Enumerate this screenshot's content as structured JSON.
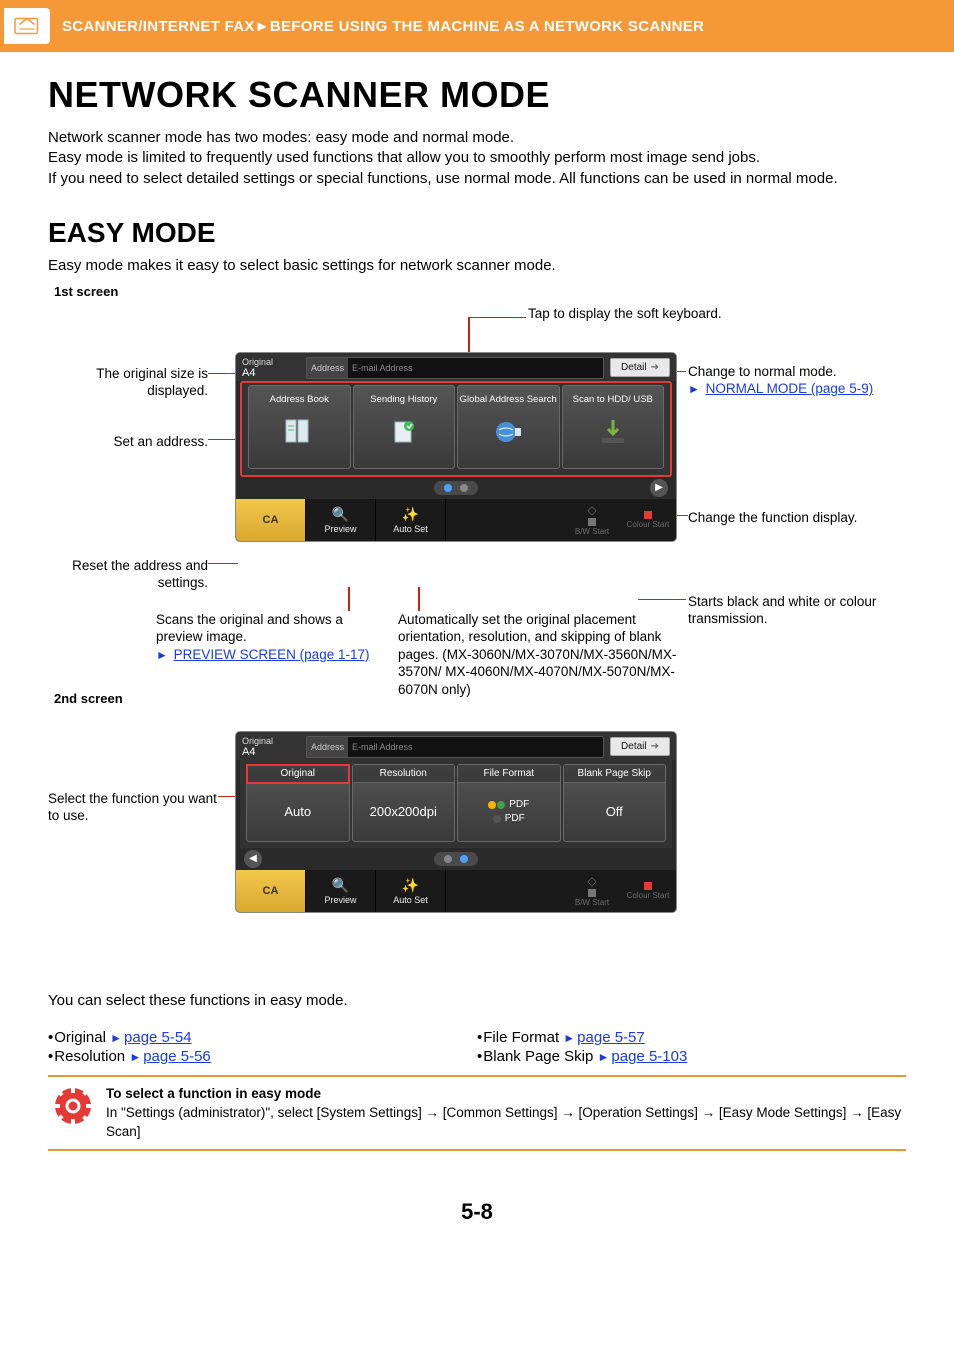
{
  "header": {
    "breadcrumb": "SCANNER/INTERNET FAX►BEFORE USING THE MACHINE AS A NETWORK SCANNER"
  },
  "title": "NETWORK SCANNER MODE",
  "intro": [
    "Network scanner mode has two modes: easy mode and normal mode.",
    "Easy mode is limited to frequently used functions that allow you to smoothly perform most image send jobs.",
    "If you need to select detailed settings or special functions, use normal mode. All functions can be used in normal mode."
  ],
  "easy": {
    "heading": "EASY MODE",
    "desc": "Easy mode makes it easy to select basic settings for network scanner mode.",
    "screen1_label": "1st screen",
    "screen2_label": "2nd screen"
  },
  "callouts": {
    "soft_keyboard": "Tap to display the soft keyboard.",
    "original_size": "The original size is displayed.",
    "set_address": "Set an address.",
    "change_normal": "Change to normal mode.",
    "normal_link": "NORMAL MODE (page 5-9)",
    "change_func": "Change the function display.",
    "starts_bw": "Starts black and white or colour transmission.",
    "reset": "Reset the address and settings.",
    "preview_desc": "Scans the original and shows a preview image.",
    "preview_link": "PREVIEW SCREEN (page 1-17)",
    "autoset_desc": "Automatically set the original placement orientation, resolution, and skipping of blank pages. (MX-3060N/MX-3070N/MX-3560N/MX-3570N/ MX-4060N/MX-4070N/MX-5070N/MX-6070N only)",
    "select_func": "Select the function you want to use."
  },
  "device": {
    "original_label": "Original",
    "original_value": "A4",
    "address_label": "Address",
    "address_placeholder": "E-mail Address",
    "detail": "Detail",
    "tiles": {
      "address_book": "Address Book",
      "sending_history": "Sending History",
      "global_search": "Global Address Search",
      "scan_hdd": "Scan to HDD/ USB"
    },
    "ca": "CA",
    "preview": "Preview",
    "autoset": "Auto Set",
    "bw": "B/W Start",
    "colour": "Colour Start"
  },
  "device2": {
    "tiles": {
      "original": {
        "label": "Original",
        "value": "Auto"
      },
      "resolution": {
        "label": "Resolution",
        "value": "200x200dpi"
      },
      "fileformat": {
        "label": "File Format",
        "pdf": "PDF"
      },
      "blank": {
        "label": "Blank Page Skip",
        "value": "Off"
      }
    }
  },
  "functions": {
    "intro": "You can select these functions in easy mode.",
    "left": [
      {
        "label": "Original",
        "link": "page 5-54"
      },
      {
        "label": "Resolution",
        "link": "page 5-56"
      }
    ],
    "right": [
      {
        "label": "File Format",
        "link": "page 5-57"
      },
      {
        "label": "Blank Page Skip",
        "link": "page 5-103"
      }
    ]
  },
  "note": {
    "title": "To select a function in easy mode",
    "body": "In \"Settings (administrator)\", select [System Settings] → [Common Settings] → [Operation Settings] → [Easy Mode Settings] → [Easy Scan]"
  },
  "page_number": "5-8"
}
